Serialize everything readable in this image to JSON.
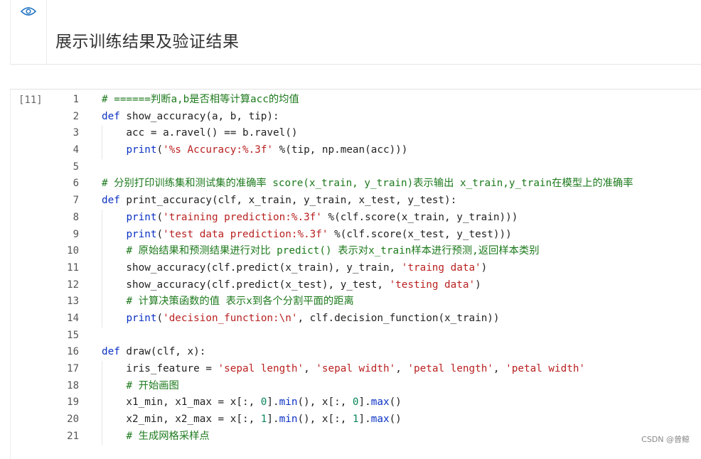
{
  "markdown_cell": {
    "title": "展示训练结果及验证结果",
    "icon": "eye-icon"
  },
  "code_cell": {
    "prompt": "[11]",
    "lines": [
      {
        "n": "1",
        "indent": false,
        "tokens": [
          {
            "t": "c",
            "v": "# ======判断a,b是否相等计算acc的均值"
          }
        ]
      },
      {
        "n": "2",
        "indent": false,
        "tokens": [
          {
            "t": "k",
            "v": "def"
          },
          {
            "t": "p",
            "v": " show_accuracy(a, b, tip):"
          }
        ]
      },
      {
        "n": "3",
        "indent": true,
        "tokens": [
          {
            "t": "p",
            "v": "    acc = a.ravel() == b.ravel()"
          }
        ]
      },
      {
        "n": "4",
        "indent": true,
        "tokens": [
          {
            "t": "p",
            "v": "    "
          },
          {
            "t": "k",
            "v": "print"
          },
          {
            "t": "p",
            "v": "("
          },
          {
            "t": "s",
            "v": "'%s Accuracy:%.3f'"
          },
          {
            "t": "p",
            "v": " %(tip, np.mean(acc)))"
          }
        ]
      },
      {
        "n": "5",
        "indent": false,
        "tokens": []
      },
      {
        "n": "6",
        "indent": false,
        "tokens": [
          {
            "t": "c",
            "v": "# 分别打印训练集和测试集的准确率 score(x_train, y_train)表示输出 x_train,y_train在模型上的准确率"
          }
        ]
      },
      {
        "n": "7",
        "indent": false,
        "tokens": [
          {
            "t": "k",
            "v": "def"
          },
          {
            "t": "p",
            "v": " print_accuracy(clf, x_train, y_train, x_test, y_test):"
          }
        ]
      },
      {
        "n": "8",
        "indent": true,
        "tokens": [
          {
            "t": "p",
            "v": "    "
          },
          {
            "t": "k",
            "v": "print"
          },
          {
            "t": "p",
            "v": "("
          },
          {
            "t": "s",
            "v": "'training prediction:%.3f'"
          },
          {
            "t": "p",
            "v": " %(clf.score(x_train, y_train)))"
          }
        ]
      },
      {
        "n": "9",
        "indent": true,
        "tokens": [
          {
            "t": "p",
            "v": "    "
          },
          {
            "t": "k",
            "v": "print"
          },
          {
            "t": "p",
            "v": "("
          },
          {
            "t": "s",
            "v": "'test data prediction:%.3f'"
          },
          {
            "t": "p",
            "v": " %(clf.score(x_test, y_test)))"
          }
        ]
      },
      {
        "n": "10",
        "indent": true,
        "tokens": [
          {
            "t": "p",
            "v": "    "
          },
          {
            "t": "c",
            "v": "# 原始结果和预测结果进行对比 predict() 表示对x_train样本进行预测,返回样本类别"
          }
        ]
      },
      {
        "n": "11",
        "indent": true,
        "tokens": [
          {
            "t": "p",
            "v": "    show_accuracy(clf.predict(x_train), y_train, "
          },
          {
            "t": "s",
            "v": "'traing data'"
          },
          {
            "t": "p",
            "v": ")"
          }
        ]
      },
      {
        "n": "12",
        "indent": true,
        "tokens": [
          {
            "t": "p",
            "v": "    show_accuracy(clf.predict(x_test), y_test, "
          },
          {
            "t": "s",
            "v": "'testing data'"
          },
          {
            "t": "p",
            "v": ")"
          }
        ]
      },
      {
        "n": "13",
        "indent": true,
        "tokens": [
          {
            "t": "p",
            "v": "    "
          },
          {
            "t": "c",
            "v": "# 计算决策函数的值 表示x到各个分割平面的距离"
          }
        ]
      },
      {
        "n": "14",
        "indent": true,
        "tokens": [
          {
            "t": "p",
            "v": "    "
          },
          {
            "t": "k",
            "v": "print"
          },
          {
            "t": "p",
            "v": "("
          },
          {
            "t": "s",
            "v": "'decision_function:\\n'"
          },
          {
            "t": "p",
            "v": ", clf.decision_function(x_train))"
          }
        ]
      },
      {
        "n": "15",
        "indent": false,
        "tokens": []
      },
      {
        "n": "16",
        "indent": false,
        "tokens": [
          {
            "t": "k",
            "v": "def"
          },
          {
            "t": "p",
            "v": " draw(clf, x):"
          }
        ]
      },
      {
        "n": "17",
        "indent": true,
        "tokens": [
          {
            "t": "p",
            "v": "    iris_feature = "
          },
          {
            "t": "s",
            "v": "'sepal length'"
          },
          {
            "t": "p",
            "v": ", "
          },
          {
            "t": "s",
            "v": "'sepal width'"
          },
          {
            "t": "p",
            "v": ", "
          },
          {
            "t": "s",
            "v": "'petal length'"
          },
          {
            "t": "p",
            "v": ", "
          },
          {
            "t": "s",
            "v": "'petal width'"
          }
        ]
      },
      {
        "n": "18",
        "indent": true,
        "tokens": [
          {
            "t": "p",
            "v": "    "
          },
          {
            "t": "c",
            "v": "# 开始画图"
          }
        ]
      },
      {
        "n": "19",
        "indent": true,
        "tokens": [
          {
            "t": "p",
            "v": "    x1_min, x1_max = x[:, "
          },
          {
            "t": "n",
            "v": "0"
          },
          {
            "t": "p",
            "v": "]."
          },
          {
            "t": "k",
            "v": "min"
          },
          {
            "t": "p",
            "v": "(), x[:, "
          },
          {
            "t": "n",
            "v": "0"
          },
          {
            "t": "p",
            "v": "]."
          },
          {
            "t": "k",
            "v": "max"
          },
          {
            "t": "p",
            "v": "()"
          }
        ]
      },
      {
        "n": "20",
        "indent": true,
        "tokens": [
          {
            "t": "p",
            "v": "    x2_min, x2_max = x[:, "
          },
          {
            "t": "n",
            "v": "1"
          },
          {
            "t": "p",
            "v": "]."
          },
          {
            "t": "k",
            "v": "min"
          },
          {
            "t": "p",
            "v": "(), x[:, "
          },
          {
            "t": "n",
            "v": "1"
          },
          {
            "t": "p",
            "v": "]."
          },
          {
            "t": "k",
            "v": "max"
          },
          {
            "t": "p",
            "v": "()"
          }
        ]
      },
      {
        "n": "21",
        "indent": true,
        "tokens": [
          {
            "t": "p",
            "v": "    "
          },
          {
            "t": "c",
            "v": "# 生成网格采样点"
          }
        ]
      }
    ]
  },
  "watermark": "CSDN @曾鲸"
}
